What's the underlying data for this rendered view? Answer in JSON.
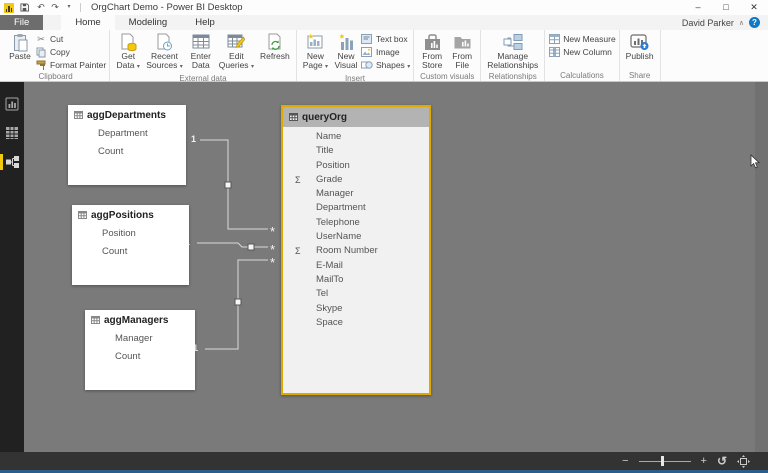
{
  "ui": {
    "dropdown_caret": "▾",
    "account_caret": "∧",
    "help_glyph": "?",
    "undo": "↶",
    "redo": "↷",
    "scissors": "✂",
    "sigma": "Σ",
    "minus": "−",
    "plus": "+",
    "reset_glyph": "↺"
  },
  "titlebar": {
    "title": "OrgChart Demo - Power BI Desktop",
    "minimize": "–",
    "maximize": "□",
    "close": "✕"
  },
  "tabs": {
    "file": "File",
    "home": "Home",
    "modeling": "Modeling",
    "help": "Help"
  },
  "account": {
    "name": "David Parker"
  },
  "ribbon": {
    "clipboard": {
      "label": "Clipboard",
      "paste": "Paste",
      "cut": "Cut",
      "copy": "Copy",
      "format_painter": "Format Painter"
    },
    "external_data": {
      "label": "External data",
      "get_1": "Get",
      "get_2": "Data",
      "recent_1": "Recent",
      "recent_2": "Sources",
      "enter_1": "Enter",
      "enter_2": "Data",
      "edit_1": "Edit",
      "edit_2": "Queries",
      "refresh": "Refresh"
    },
    "insert": {
      "label": "Insert",
      "newpage_1": "New",
      "newpage_2": "Page",
      "newvisual_1": "New",
      "newvisual_2": "Visual",
      "text_box": "Text box",
      "image": "Image",
      "shapes": "Shapes"
    },
    "custom_visuals": {
      "label": "Custom visuals",
      "store_1": "From",
      "store_2": "Store",
      "file_1": "From",
      "file_2": "File"
    },
    "relationships": {
      "label": "Relationships",
      "manage_1": "Manage",
      "manage_2": "Relationships"
    },
    "calculations": {
      "label": "Calculations",
      "new_measure": "New Measure",
      "new_column": "New Column"
    },
    "share": {
      "label": "Share",
      "publish": "Publish"
    }
  },
  "canvas": {
    "tables": [
      {
        "name": "aggDepartments",
        "fields": [
          {
            "name": "Department"
          },
          {
            "name": "Count"
          }
        ]
      },
      {
        "name": "aggPositions",
        "fields": [
          {
            "name": "Position"
          },
          {
            "name": "Count"
          }
        ]
      },
      {
        "name": "aggManagers",
        "fields": [
          {
            "name": "Manager"
          },
          {
            "name": "Count"
          }
        ]
      },
      {
        "name": "queryOrg",
        "selected": true,
        "fields": [
          {
            "name": "Name"
          },
          {
            "name": "Title"
          },
          {
            "name": "Position"
          },
          {
            "name": "Grade",
            "sigma": true
          },
          {
            "name": "Manager"
          },
          {
            "name": "Department"
          },
          {
            "name": "Telephone"
          },
          {
            "name": "UserName"
          },
          {
            "name": "Room Number",
            "sigma": true
          },
          {
            "name": "E-Mail"
          },
          {
            "name": "MailTo"
          },
          {
            "name": "Tel"
          },
          {
            "name": "Skype"
          },
          {
            "name": "Space"
          }
        ]
      }
    ],
    "relationships": [
      {
        "from": "aggDepartments",
        "to": "queryOrg",
        "from_cardinality": "1",
        "to_cardinality": "*"
      },
      {
        "from": "aggPositions",
        "to": "queryOrg",
        "from_cardinality": "1",
        "to_cardinality": "*"
      },
      {
        "from": "aggManagers",
        "to": "queryOrg",
        "from_cardinality": "1",
        "to_cardinality": "*"
      }
    ]
  },
  "colors": {
    "accent_yellow": "#f2c811",
    "selection_border": "#e0a900",
    "canvas_bg": "#7a7a7a",
    "sidebar_bg": "#212121",
    "statusbar_bg": "#333333",
    "taskbar_blue": "#2b5d8b",
    "help_blue": "#0b78c9"
  }
}
